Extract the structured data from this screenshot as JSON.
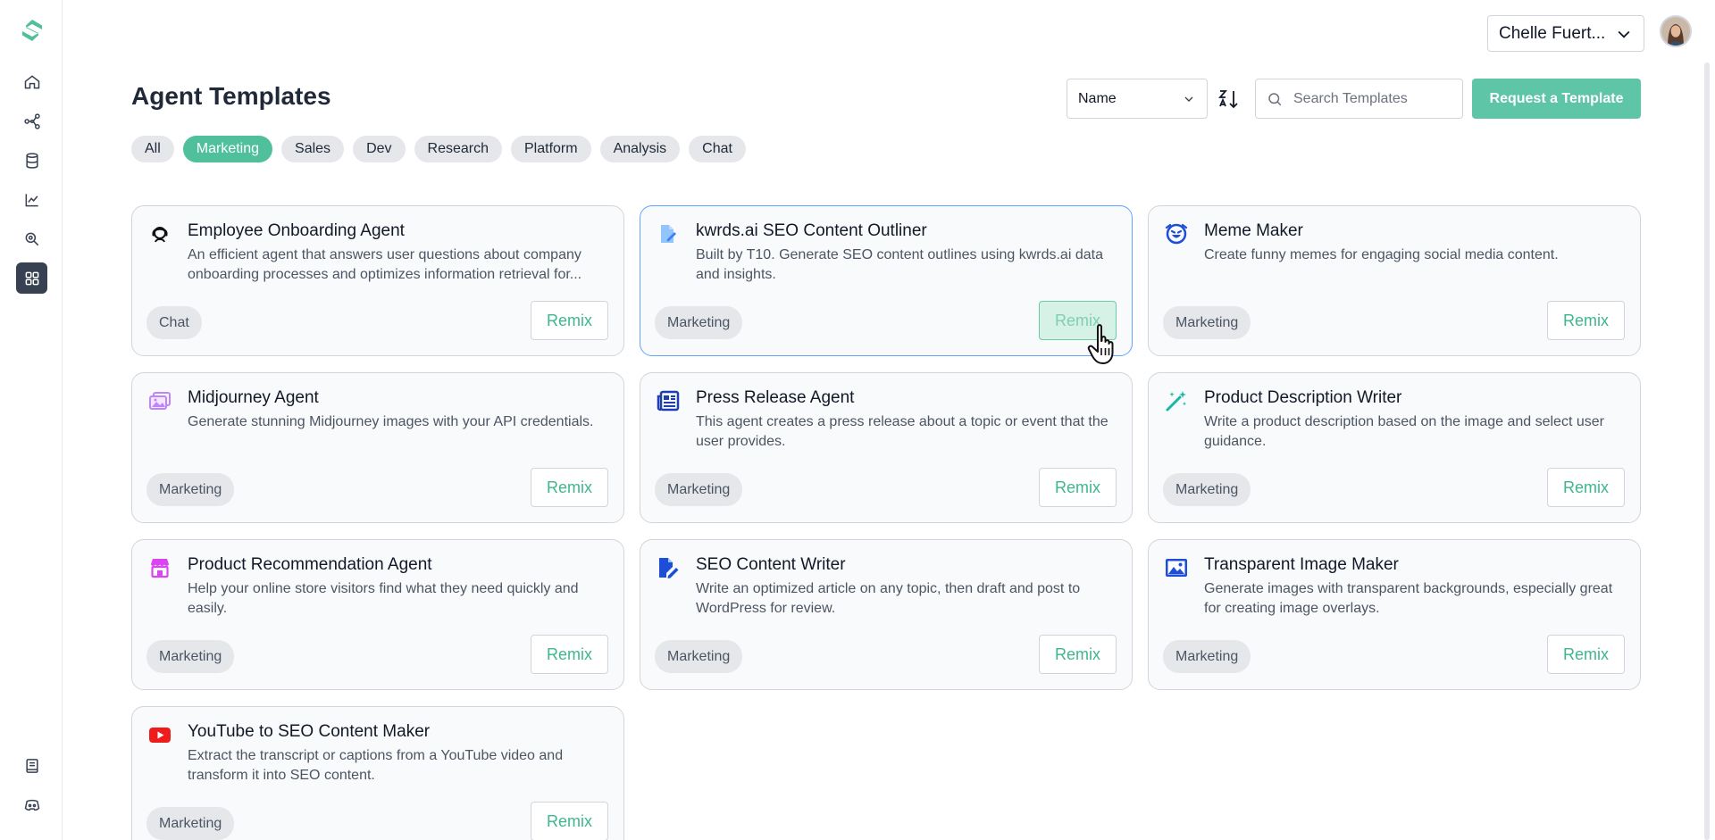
{
  "user": {
    "name": "Chelle Fuert..."
  },
  "header": {
    "title": "Agent Templates",
    "sort_value": "Name",
    "search_placeholder": "Search Templates",
    "request_label": "Request a Template"
  },
  "filters": [
    "All",
    "Marketing",
    "Sales",
    "Dev",
    "Research",
    "Platform",
    "Analysis",
    "Chat"
  ],
  "active_filter": "Marketing",
  "accent_color": "#4fbf9c",
  "remix_label": "Remix",
  "cards": [
    {
      "title": "Employee Onboarding Agent",
      "desc": "An efficient agent that answers user questions about company onboarding processes and optimizes information retrieval for...",
      "tag": "Chat",
      "icon": "headset-person-icon"
    },
    {
      "title": "kwrds.ai SEO Content Outliner",
      "desc": "Built by T10. Generate SEO content outlines using kwrds.ai data and insights.",
      "tag": "Marketing",
      "icon": "document-edit-icon"
    },
    {
      "title": "Meme Maker",
      "desc": "Create funny memes for engaging social media content.",
      "tag": "Marketing",
      "icon": "laughing-face-icon"
    },
    {
      "title": "Midjourney Agent",
      "desc": "Generate stunning Midjourney images with your API credentials.",
      "tag": "Marketing",
      "icon": "images-icon"
    },
    {
      "title": "Press Release Agent",
      "desc": "This agent creates a press release about a topic or event that the user provides.",
      "tag": "Marketing",
      "icon": "newspaper-icon"
    },
    {
      "title": "Product Description Writer",
      "desc": "Write a product description based on the image and select user guidance.",
      "tag": "Marketing",
      "icon": "magic-wand-icon"
    },
    {
      "title": "Product Recommendation Agent",
      "desc": "Help your online store visitors find what they need quickly and easily.",
      "tag": "Marketing",
      "icon": "store-icon"
    },
    {
      "title": "SEO Content Writer",
      "desc": "Write an optimized article on any topic, then draft and post to WordPress for review.",
      "tag": "Marketing",
      "icon": "file-pen-icon"
    },
    {
      "title": "Transparent Image Maker",
      "desc": "Generate images with transparent backgrounds, especially great for creating image overlays.",
      "tag": "Marketing",
      "icon": "image-icon"
    },
    {
      "title": "YouTube to SEO Content Maker",
      "desc": "Extract the transcript or captions from a YouTube video and transform it into SEO content.",
      "tag": "Marketing",
      "icon": "youtube-icon"
    }
  ]
}
